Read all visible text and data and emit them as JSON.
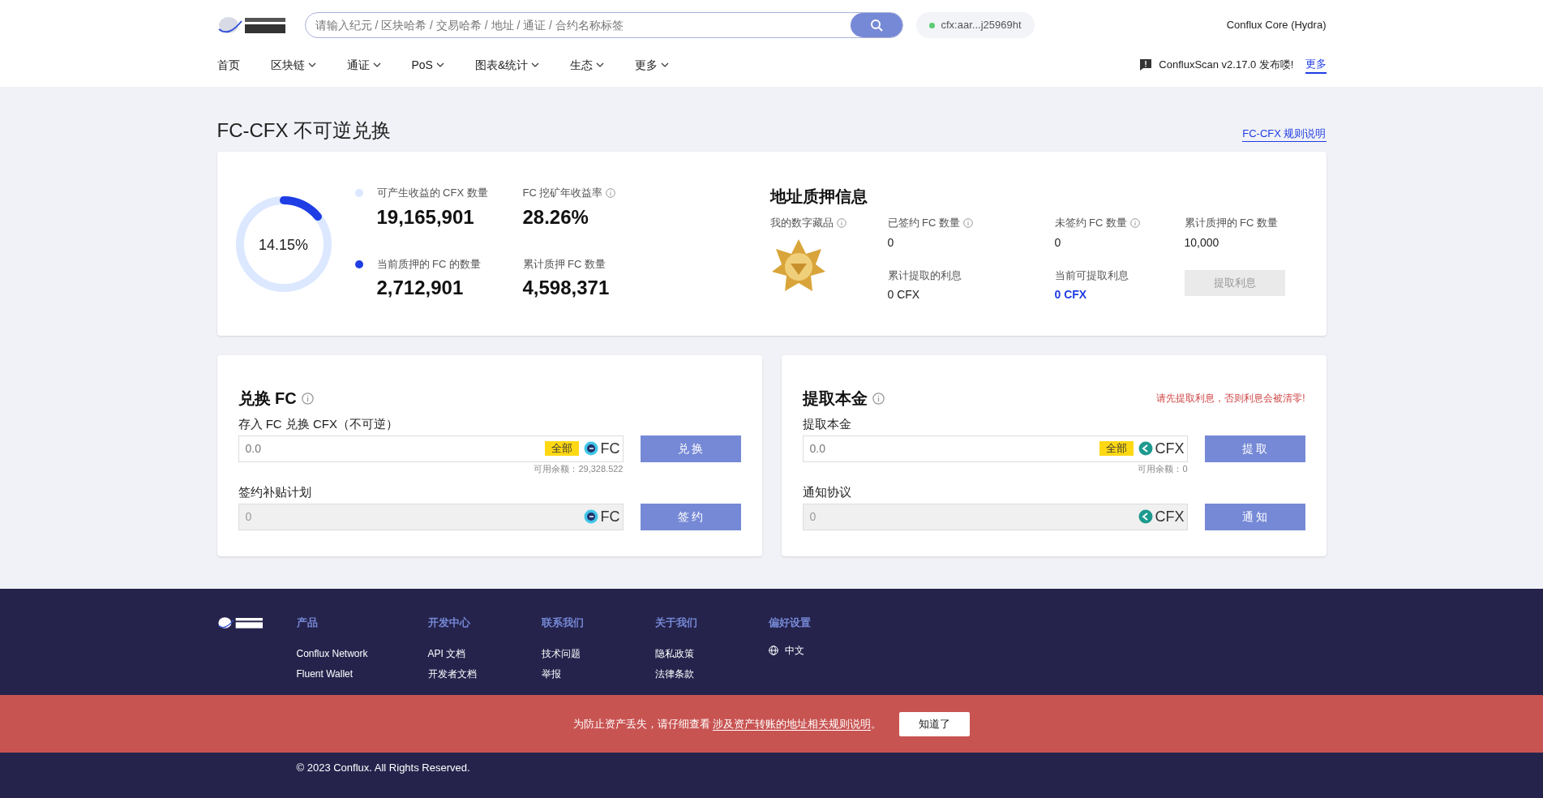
{
  "header": {
    "search_placeholder": "请输入纪元 / 区块哈希 / 交易哈希 / 地址 / 通证 / 合约名称标签",
    "account": "cfx:aar...j25969ht",
    "network": "Conflux Core (Hydra)",
    "nav": [
      {
        "label": "首页",
        "dropdown": false
      },
      {
        "label": "区块链",
        "dropdown": true
      },
      {
        "label": "通证",
        "dropdown": true
      },
      {
        "label": "PoS",
        "dropdown": true
      },
      {
        "label": "图表&统计",
        "dropdown": true
      },
      {
        "label": "生态",
        "dropdown": true
      },
      {
        "label": "更多",
        "dropdown": true
      }
    ],
    "notice": "ConfluxScan v2.17.0 发布喽!",
    "notice_link": "更多"
  },
  "page": {
    "title": "FC-CFX 不可逆兑换",
    "rules_link": "FC-CFX 规则说明"
  },
  "overview": {
    "donut": {
      "level": 0.1415,
      "reading": "14.15%"
    },
    "stats": [
      {
        "label": "可产生收益的 CFX 数量",
        "value": "19,165,901",
        "color": "#dbe8ff",
        "info": false
      },
      {
        "label": "FC 挖矿年收益率",
        "value": "28.26%",
        "info": true
      },
      {
        "label": "当前质押的 FC 的数量",
        "value": "2,712,901",
        "color": "#1e3de4",
        "info": false
      },
      {
        "label": "累计质押 FC 数量",
        "value": "4,598,371",
        "info": false
      }
    ],
    "pledge": {
      "title": "地址质押信息",
      "nft_label": "我的数字藏品",
      "items": [
        {
          "label": "已签约 FC 数量",
          "value": "0",
          "info": true,
          "highlight": false
        },
        {
          "label": "未签约 FC 数量",
          "value": "0",
          "info": true,
          "highlight": false
        },
        {
          "label": "累计质押的 FC 数量",
          "value": "10,000",
          "info": false,
          "highlight": false
        },
        {
          "label": "累计提取的利息",
          "value": "0 CFX",
          "info": false,
          "highlight": false
        },
        {
          "label": "当前可提取利息",
          "value": "0 CFX",
          "info": false,
          "highlight": true
        }
      ],
      "button": {
        "label": "提取利息",
        "disabled": true
      }
    }
  },
  "panels": [
    {
      "title": "兑换 FC",
      "rows": [
        {
          "label": "存入 FC 兑换 CFX（不可逆）",
          "placeholder": "0.0",
          "all": "全部",
          "token": "FC",
          "balance": "可用余额：29,328.522",
          "button": "兑 换",
          "disabled": false
        },
        {
          "label": "签约补贴计划",
          "placeholder": "0",
          "token": "FC",
          "button": "签 约",
          "disabled": true
        }
      ]
    },
    {
      "title": "提取本金",
      "warning": "请先提取利息，否则利息会被清零!",
      "rows": [
        {
          "label": "提取本金",
          "placeholder": "0.0",
          "all": "全部",
          "token": "CFX",
          "balance": "可用余额：0",
          "button": "提 取",
          "disabled": false
        },
        {
          "label": "通知协议",
          "placeholder": "0",
          "token": "CFX",
          "button": "通 知",
          "disabled": true
        }
      ]
    }
  ],
  "footer": {
    "columns": [
      {
        "title": "产品",
        "links": [
          "Conflux Network",
          "Fluent Wallet"
        ]
      },
      {
        "title": "开发中心",
        "links": [
          "API 文档",
          "开发者文档"
        ]
      },
      {
        "title": "联系我们",
        "links": [
          "技术问题",
          "举报"
        ]
      },
      {
        "title": "关于我们",
        "links": [
          "隐私政策",
          "法律条款"
        ]
      }
    ],
    "prefs_title": "偏好设置",
    "language": "中文",
    "copyright": "© 2023 Conflux. All Rights Reserved."
  },
  "banner": {
    "text": "为防止资产丢失，请仔细查看 ",
    "link": "涉及资产转账的地址相关规则说明",
    "end": "。",
    "button": "知道了"
  }
}
